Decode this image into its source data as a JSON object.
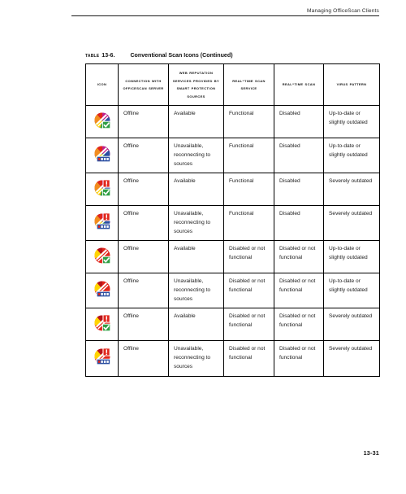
{
  "header": {
    "running_head": "Managing OfficeScan Clients"
  },
  "caption": {
    "label": "Table",
    "number": "13-6.",
    "title": "Conventional Scan Icons (Continued)"
  },
  "table": {
    "columns": [
      {
        "id": "icon",
        "label": "Icon"
      },
      {
        "id": "conn",
        "label": "Connection with OfficeScan Server"
      },
      {
        "id": "wrs",
        "label": "Web Reputation Services provided by Smart Protection Sources"
      },
      {
        "id": "rtss",
        "label": "Real-time Scan Service"
      },
      {
        "id": "rts",
        "label": "Real-time Scan"
      },
      {
        "id": "virus",
        "label": "Virus Pattern"
      }
    ],
    "rows": [
      {
        "icon": "offline-multicolor-check-icon",
        "icon_desc": "multicolor disc with green check badge",
        "connection": "Offline",
        "web_reputation": "Available",
        "realtime_scan_service": "Functional",
        "realtime_scan": "Disabled",
        "virus_pattern": "Up-to-date or slightly outdated"
      },
      {
        "icon": "offline-multicolor-bar-icon",
        "icon_desc": "multicolor disc with blue bar badge",
        "connection": "Offline",
        "web_reputation": "Unavailable, reconnecting to sources",
        "realtime_scan_service": "Functional",
        "realtime_scan": "Disabled",
        "virus_pattern": "Up-to-date or slightly outdated"
      },
      {
        "icon": "offline-multicolor-alert-check-icon",
        "icon_desc": "multicolor disc with red alert badge and green check badge",
        "connection": "Offline",
        "web_reputation": "Available",
        "realtime_scan_service": "Functional",
        "realtime_scan": "Disabled",
        "virus_pattern": "Severely outdated"
      },
      {
        "icon": "offline-multicolor-alert-bar-icon",
        "icon_desc": "multicolor disc with red alert badge and blue bar badge",
        "connection": "Offline",
        "web_reputation": "Unavailable, reconnecting to sources",
        "realtime_scan_service": "Functional",
        "realtime_scan": "Disabled",
        "virus_pattern": "Severely outdated"
      },
      {
        "icon": "offline-red-check-icon",
        "icon_desc": "red disc with green check badge",
        "connection": "Offline",
        "web_reputation": "Available",
        "realtime_scan_service": "Disabled or not functional",
        "realtime_scan": "Disabled or not functional",
        "virus_pattern": "Up-to-date or slightly outdated"
      },
      {
        "icon": "offline-red-bar-icon",
        "icon_desc": "red disc with blue bar badge",
        "connection": "Offline",
        "web_reputation": "Unavailable, reconnecting to sources",
        "realtime_scan_service": "Disabled or not functional",
        "realtime_scan": "Disabled or not functional",
        "virus_pattern": "Up-to-date or slightly outdated"
      },
      {
        "icon": "offline-red-alert-check-icon",
        "icon_desc": "red disc with red alert badge and green check badge",
        "connection": "Offline",
        "web_reputation": "Available",
        "realtime_scan_service": "Disabled or not functional",
        "realtime_scan": "Disabled or not functional",
        "virus_pattern": "Severely outdated"
      },
      {
        "icon": "offline-red-alert-bar-icon",
        "icon_desc": "red disc with red alert badge and blue bar badge",
        "connection": "Offline",
        "web_reputation": "Unavailable, reconnecting to sources",
        "realtime_scan_service": "Disabled or not functional",
        "realtime_scan": "Disabled or not functional",
        "virus_pattern": "Severely outdated"
      }
    ]
  },
  "footer": {
    "page_number": "13-31"
  },
  "colors": {
    "rule": "#1a1a1a",
    "border": "#000000",
    "text": "#1c1c1c",
    "icon_red": "#e1251b",
    "icon_dark_red": "#b8141a",
    "icon_orange": "#f28c1e",
    "icon_yellow": "#ffd400",
    "icon_green": "#2f9e44",
    "icon_blue": "#2b4fa2",
    "icon_purple": "#7b2f8c",
    "icon_magenta": "#c2208a",
    "badge_white": "#ffffff"
  }
}
